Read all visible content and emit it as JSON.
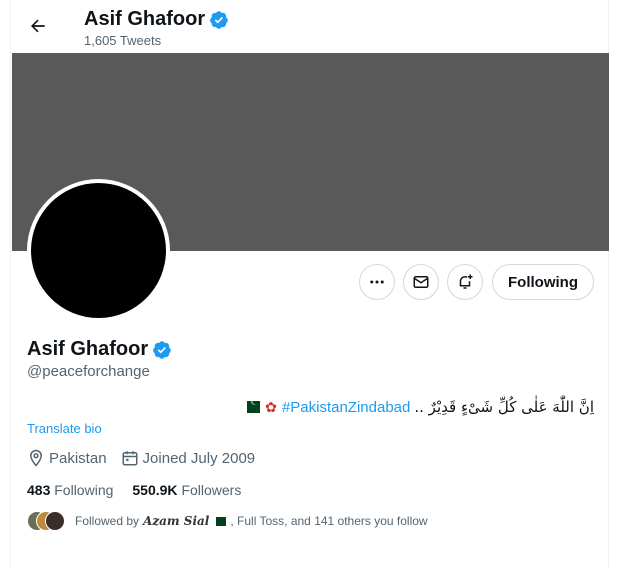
{
  "header": {
    "name": "Asif Ghafoor",
    "tweet_count": "1,605 Tweets"
  },
  "profile": {
    "name": "Asif Ghafoor",
    "handle": "@peaceforchange",
    "bio_arabic": "اِنَّ اللّٰهَ عَلٰی کُلِّ شَیْءٍ قَدِیْرٌ ..",
    "bio_hashtag": "#PakistanZindabad",
    "translate_label": "Translate bio",
    "location": "Pakistan",
    "joined": "Joined July 2009",
    "following_count": "483",
    "following_label": "Following",
    "followers_count": "550.9K",
    "followers_label": "Followers",
    "followed_by_prefix": "Followed by",
    "followed_by_name": "Azam Sial",
    "followed_by_suffix": ", Full Toss, and 141 others you follow"
  },
  "actions": {
    "follow_label": "Following"
  },
  "colors": {
    "accent": "#1d9bf0",
    "banner": "#595959",
    "verified": "#1d9bf0",
    "muted_text": "#536471"
  },
  "icons": [
    "back-arrow-icon",
    "verified-badge-icon",
    "more-icon",
    "message-icon",
    "notification-bell-icon",
    "location-icon",
    "calendar-icon"
  ]
}
